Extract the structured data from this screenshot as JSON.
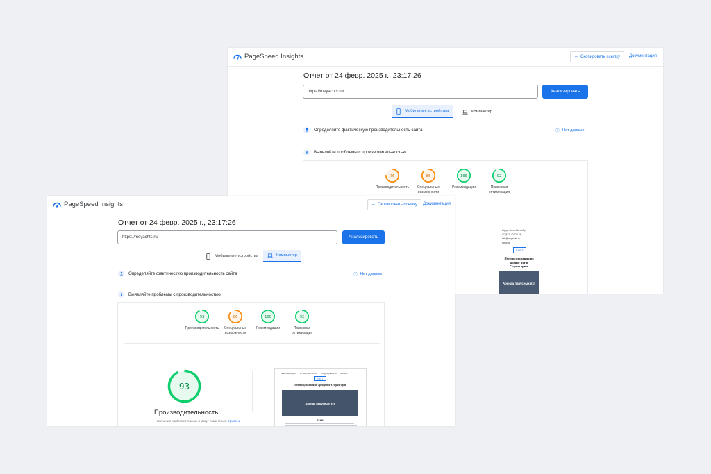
{
  "app": {
    "name": "PageSpeed Insights"
  },
  "header": {
    "copy_link": "Скопировать ссылку",
    "docs": "Документация"
  },
  "report": {
    "title": "Отчет от 24 февр. 2025 г., 23:17:26",
    "url": "https://meyachts.ru/",
    "analyze_label": "Анализировать"
  },
  "tabs": {
    "mobile": "Мобильные устройства",
    "desktop": "Компьютер"
  },
  "sections": {
    "field_data": "Определяйте фактическую производительность сайта",
    "no_data": "Нет данных",
    "diagnose": "Выявляйте проблемы с производительностью"
  },
  "mobile_report": {
    "active_tab": "mobile",
    "scores": [
      {
        "label_lines": [
          "Производительность"
        ],
        "value": "76",
        "color": "#fa8c0f"
      },
      {
        "label_lines": [
          "Специальные",
          "возможности"
        ],
        "value": "86",
        "color": "#fa8c0f"
      },
      {
        "label_lines": [
          "Рекомендации"
        ],
        "value": "100",
        "color": "#0cce6b"
      },
      {
        "label_lines": [
          "Поисковая",
          "оптимизация"
        ],
        "value": "92",
        "color": "#0cce6b"
      }
    ],
    "preview": {
      "lines": [
        "Город: Санкт-Петербург",
        "+7 (812) 407-22-24",
        "info@meyachts.ru",
        "Каталог"
      ],
      "logo": "ЕЯХТ",
      "headline": "Яхт предложения по аренде яхт в Черногории",
      "hero": "Аренда парусных яхт"
    }
  },
  "desktop_report": {
    "active_tab": "desktop",
    "scores": [
      {
        "label_lines": [
          "Производительность"
        ],
        "value": "93",
        "color": "#0cce6b"
      },
      {
        "label_lines": [
          "Специальные",
          "возможности"
        ],
        "value": "86",
        "color": "#fa8c0f"
      },
      {
        "label_lines": [
          "Рекомендации"
        ],
        "value": "100",
        "color": "#0cce6b"
      },
      {
        "label_lines": [
          "Поисковая",
          "оптимизация"
        ],
        "value": "92",
        "color": "#0cce6b"
      }
    ],
    "main_score": {
      "value": "93",
      "fraction": 0.93,
      "label": "Производительность",
      "color": "#0cce6b"
    },
    "note": {
      "text": "Значения приблизительные и могут изменяться.",
      "link": "Уровень"
    },
    "preview": {
      "nav": [
        "Санкт-Петербург",
        "+7 (812) 407-22-24",
        "info@meyachts.ru",
        "Каталог"
      ],
      "logo": "ЕЯХТ",
      "headline": "Яхт предложения по аренде яхт в Черногории",
      "hero": "Аренда парусных яхт",
      "subhead": "О нас"
    }
  }
}
